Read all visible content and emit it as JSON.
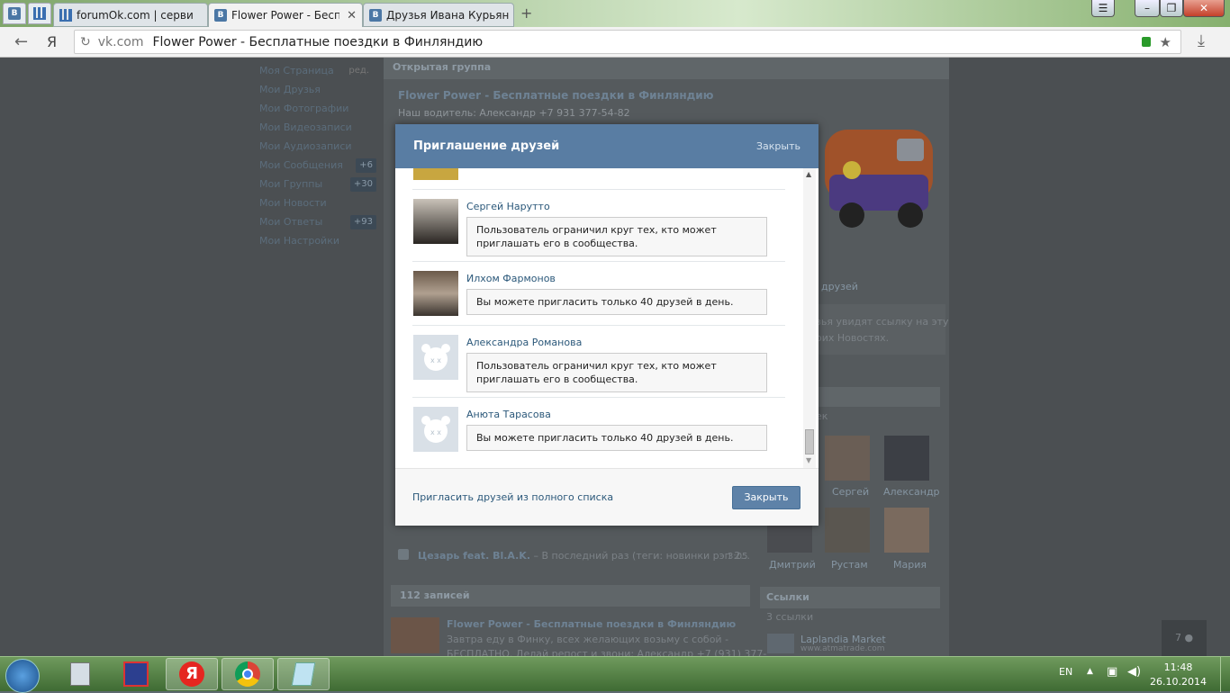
{
  "browser": {
    "tabs": [
      {
        "label": "forumOk.com | серви"
      },
      {
        "label": "Flower Power - Бесплат"
      },
      {
        "label": "Друзья Ивана Курьян"
      }
    ],
    "new_tab": "+",
    "yandex_letter": "Я",
    "address_domain": "vk.com",
    "address_title": "Flower Power - Бесплатные поездки в Финляндию"
  },
  "sidebar": {
    "edit_label": "ред.",
    "items": [
      {
        "label": "Моя Страница",
        "count": ""
      },
      {
        "label": "Мои Друзья",
        "count": ""
      },
      {
        "label": "Мои Фотографии",
        "count": ""
      },
      {
        "label": "Мои Видеозаписи",
        "count": ""
      },
      {
        "label": "Мои Аудиозаписи",
        "count": ""
      },
      {
        "label": "Мои Сообщения",
        "count": "+6"
      },
      {
        "label": "Мои Группы",
        "count": "+30"
      },
      {
        "label": "Мои Новости",
        "count": ""
      },
      {
        "label": "Мои Ответы",
        "count": "+93"
      },
      {
        "label": "Мои Настройки",
        "count": ""
      }
    ]
  },
  "group": {
    "type_header": "Открытая группа",
    "name": "Flower Power - Бесплатные поездки в Финляндию",
    "driver": "Наш водитель: Александр +7 931 377-54-82",
    "friends_link": "друзей",
    "share_line1": "зья увидят ссылку на эту",
    "share_line2": "оих Новостях.",
    "members_label": "ек",
    "members": [
      "Сергей",
      "Александр",
      "Дмитрий",
      "Рустам",
      "Мария"
    ],
    "audio_title": "Цезарь feat. Bl.A.K.",
    "audio_desc": " – В последний раз (теги: новинки рэп 2...",
    "audio_time": "3:05",
    "posts_count": "112 записей",
    "post_author": "Flower Power - Бесплатные поездки в Финляндию",
    "post_text_1": "Завтра еду в Финку, всех желающих возьму с собой -",
    "post_text_2": "БЕСПЛАТНО. Делай репост и звони: Александр +7 (931) 377-",
    "links_header": "Ссылки",
    "links_count": "3 ссылки",
    "link_name": "Laplandia Market",
    "link_url": "www.atmatrade.com",
    "chat_count": "7"
  },
  "modal": {
    "title": "Приглашение друзей",
    "close_link": "Закрыть",
    "friends": [
      {
        "name": "Сергей Нарутто",
        "message": "Пользователь ограничил круг тех, кто может приглашать его в сообщества."
      },
      {
        "name": "Илхом Фармонов",
        "message": "Вы можете пригласить только 40 друзей в день."
      },
      {
        "name": "Александра Романова",
        "message": "Пользователь ограничил круг тех, кто может приглашать его в сообщества."
      },
      {
        "name": "Анюта Тарасова",
        "message": "Вы можете пригласить только 40 друзей в день."
      }
    ],
    "invite_full_list": "Пригласить друзей из полного списка",
    "close_button": "Закрыть"
  },
  "taskbar": {
    "lang": "EN",
    "time": "11:48",
    "date": "26.10.2014"
  }
}
